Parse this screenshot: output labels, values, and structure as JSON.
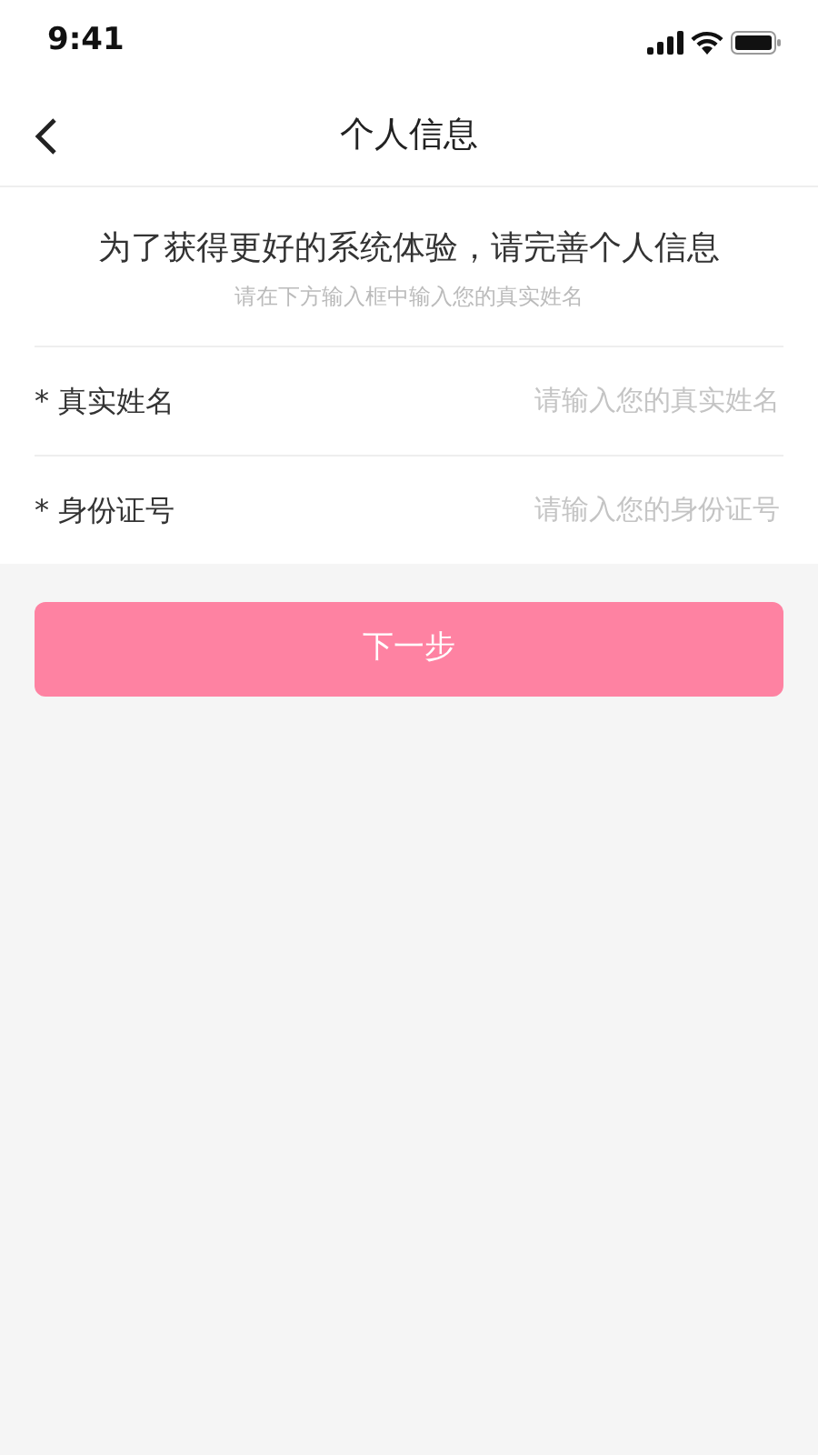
{
  "status_bar": {
    "time": "9:41"
  },
  "nav": {
    "title": "个人信息"
  },
  "intro": {
    "heading": "为了获得更好的系统体验，请完善个人信息",
    "subheading": "请在下方输入框中输入您的真实姓名"
  },
  "fields": [
    {
      "label": "* 真实姓名",
      "placeholder": "请输入您的真实姓名"
    },
    {
      "label": "* 身份证号",
      "placeholder": "请输入您的身份证号"
    }
  ],
  "next_button": {
    "label": "下一步"
  }
}
